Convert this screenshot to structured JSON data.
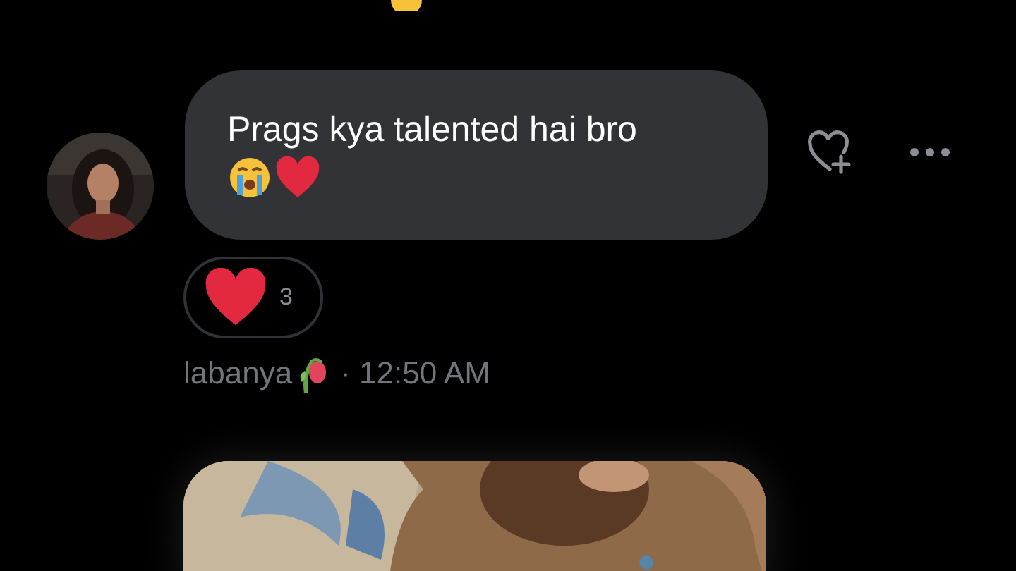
{
  "message": {
    "text": "Prags kya talented hai bro",
    "reaction": {
      "count": "3"
    },
    "sender": "labanya",
    "time": "· 12:50 AM"
  }
}
